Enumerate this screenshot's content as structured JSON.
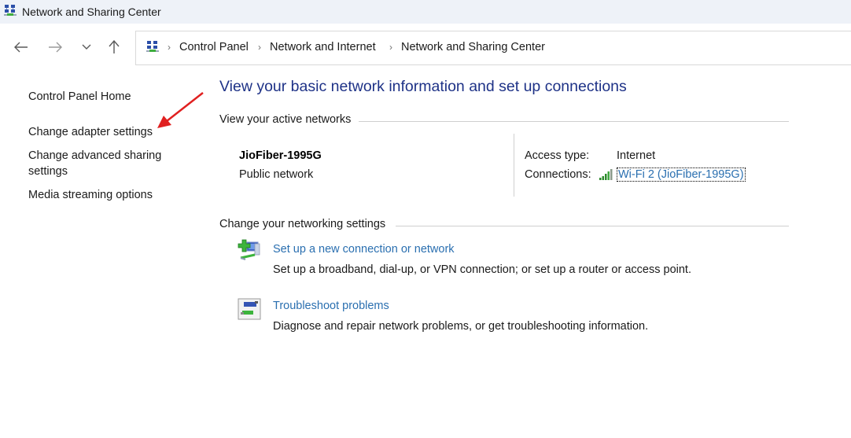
{
  "window": {
    "title": "Network and Sharing Center",
    "icon": "network-sharing-center-icon"
  },
  "nav": {
    "back_icon": "arrow-left-icon",
    "forward_icon": "arrow-right-icon",
    "recent_icon": "chevron-down-icon",
    "up_icon": "arrow-up-icon"
  },
  "breadcrumb": {
    "separator": "›",
    "items": [
      "Control Panel",
      "Network and Internet",
      "Network and Sharing Center"
    ]
  },
  "sidebar": {
    "items": [
      {
        "label": "Control Panel Home"
      },
      {
        "label": "Change adapter settings"
      },
      {
        "label": "Change advanced sharing settings"
      },
      {
        "label": "Media streaming options"
      }
    ]
  },
  "annotation": {
    "type": "red-arrow",
    "target": "Change adapter settings",
    "color": "#e02020"
  },
  "main": {
    "title": "View your basic network information and set up connections",
    "active_networks": {
      "header": "View your active networks",
      "network_name": "JioFiber-1995G",
      "network_type": "Public network",
      "access_type_label": "Access type:",
      "access_type_value": "Internet",
      "connections_label": "Connections:",
      "connection_link": "Wi-Fi 2 (JioFiber-1995G)",
      "connection_icon": "wifi-signal-icon"
    },
    "networking_settings": {
      "header": "Change your networking settings",
      "tasks": [
        {
          "icon": "new-connection-icon",
          "label": "Set up a new connection or network",
          "description": "Set up a broadband, dial-up, or VPN connection; or set up a router or access point."
        },
        {
          "icon": "troubleshoot-icon",
          "label": "Troubleshoot problems",
          "description": "Diagnose and repair network problems, or get troubleshooting information."
        }
      ]
    }
  },
  "colors": {
    "heading": "#1e3287",
    "link": "#2a6fb0",
    "titlebar_bg": "#eef2f8",
    "annotation_arrow": "#e02020"
  }
}
